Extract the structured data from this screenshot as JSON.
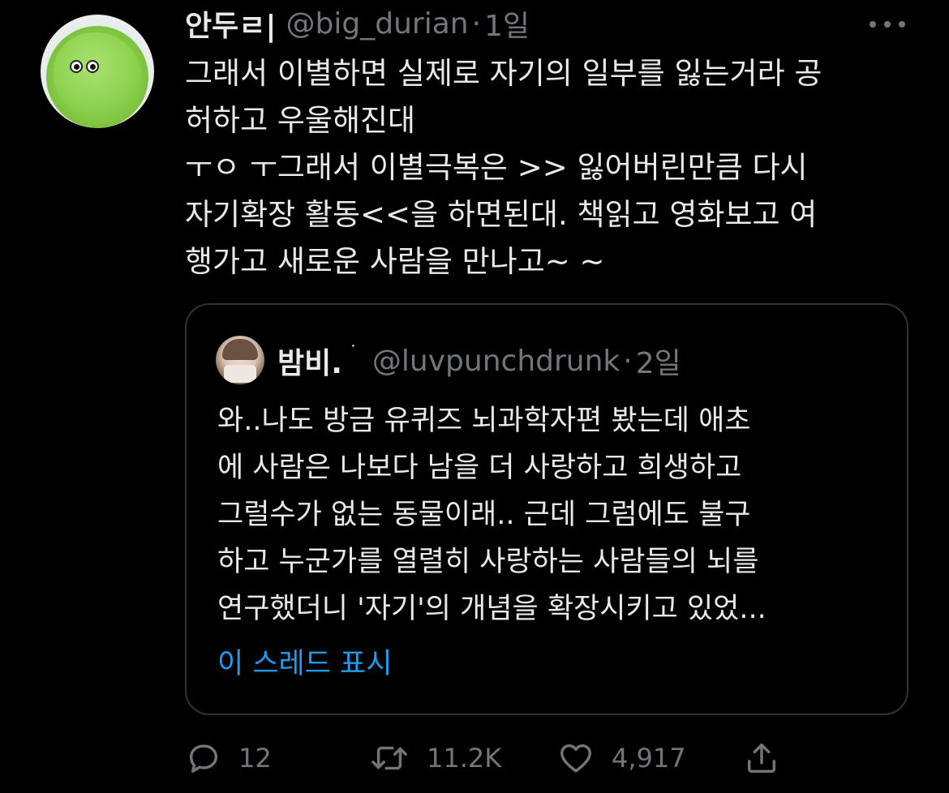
{
  "tweet": {
    "display_name": "안두ㄹ|",
    "handle": "@big_durian",
    "separator": "·",
    "time": "1일",
    "text_lines": [
      "그래서 이별하면 실제로 자기의 일부를 잃는거라 공",
      "허하고 우울해진대",
      "ㅜㅇ ㅜ그래서 이별극복은 >> 잃어버린만큼 다시",
      "자기확장 활동<<을 하면된대. 책읽고 영화보고 여",
      "행가고 새로운 사람을 만나고~ ~"
    ]
  },
  "quote": {
    "display_name": "밤비.",
    "name_mark": "˙",
    "handle": "@luvpunchdrunk",
    "separator": "·",
    "time": "2일",
    "text_lines": [
      "와..나도 방금 유퀴즈 뇌과학자편 봤는데 애초",
      "에 사람은 나보다 남을 더 사랑하고 희생하고",
      "그럴수가 없는 동물이래.. 근데 그럼에도 불구",
      "하고 누군가를 열렬히 사랑하는 사람들의 뇌를",
      "연구했더니 '자기'의 개념을 확장시키고 있었..."
    ],
    "show_thread": "이 스레드 표시"
  },
  "actions": {
    "reply_count": "12",
    "retweet_count": "11.2K",
    "like_count": "4,917"
  },
  "icons": {
    "reply": "reply-icon",
    "retweet": "retweet-icon",
    "like": "heart-icon",
    "share": "share-icon",
    "more": "more-icon"
  },
  "colors": {
    "background": "#000000",
    "text": "#e7e9ea",
    "secondary": "#71767b",
    "link": "#1d9bf0",
    "border": "#2f3336"
  }
}
